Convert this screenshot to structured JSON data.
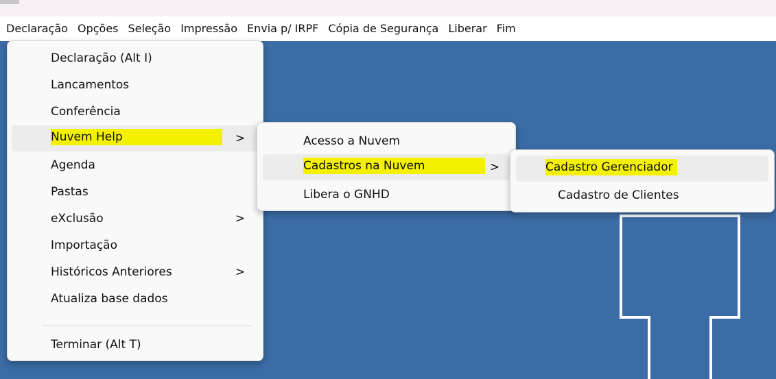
{
  "menubar": {
    "items": [
      "Declaração",
      "Opções",
      "Seleção",
      "Impressão",
      "Envia p/ IRPF",
      "Cópia de Segurança",
      "Liberar",
      "Fim"
    ]
  },
  "menu_declaracao": {
    "items": [
      {
        "label": "Declaração (Alt I)",
        "submenu": false
      },
      {
        "label": "Lancamentos",
        "submenu": false
      },
      {
        "label": "Conferência",
        "submenu": false
      },
      {
        "label": "Nuvem Help",
        "submenu": true
      },
      {
        "label": "Agenda",
        "submenu": false
      },
      {
        "label": "Pastas",
        "submenu": false
      },
      {
        "label": "eXclusão",
        "submenu": true
      },
      {
        "label": "Importação",
        "submenu": false
      },
      {
        "label": "Históricos Anteriores",
        "submenu": true
      },
      {
        "label": "Atualiza base dados",
        "submenu": false
      },
      {
        "label": "Terminar (Alt T)",
        "submenu": false
      }
    ]
  },
  "menu_nuvem": {
    "items": [
      {
        "label": "Acesso a Nuvem",
        "submenu": false
      },
      {
        "label": "Cadastros na Nuvem",
        "submenu": true
      },
      {
        "label": "Libera o GNHD",
        "submenu": false
      }
    ]
  },
  "menu_cadastros": {
    "items": [
      {
        "label": "Cadastro Gerenciador",
        "submenu": false
      },
      {
        "label": "Cadastro de Clientes",
        "submenu": false
      }
    ]
  },
  "chevron_glyph": ">",
  "colors": {
    "desktop": "#3b6ca5",
    "highlight": "#f3f000",
    "hover": "#ececec"
  }
}
